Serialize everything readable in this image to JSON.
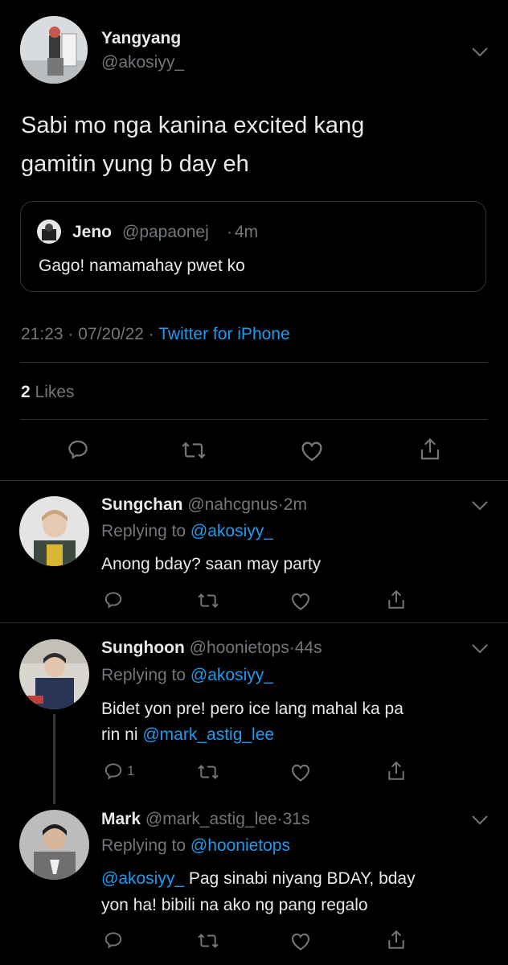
{
  "main_tweet": {
    "display_name": "Yangyang",
    "handle": "@akosiyy_",
    "text_line1": "Sabi mo nga kanina excited kang",
    "text_line2": "gamitin yung b day eh",
    "quote": {
      "display_name": "Jeno",
      "handle": "@papaonej",
      "time": "4m",
      "text": "Gago! namamahay pwet ko"
    },
    "timestamp": "21:23 · 07/20/22 · ",
    "source": "Twitter for iPhone",
    "likes_count": "2",
    "likes_label": "Likes"
  },
  "replies": [
    {
      "display_name": "Sungchan",
      "handle": "@nahcgnus",
      "time": "2m",
      "replying_label": "Replying to",
      "replying_to": "@akosiyy_",
      "text": "Anong bday? saan may party",
      "reply_count": ""
    },
    {
      "display_name": "Sunghoon",
      "handle": "@hoonietops",
      "time": "44s",
      "replying_label": "Replying to",
      "replying_to": "@akosiyy_",
      "text_line1": "Bidet yon pre! pero ice lang mahal ka pa",
      "text_line2_prefix": "rin ni ",
      "text_line2_mention": "@mark_astig_lee",
      "reply_count": "1"
    },
    {
      "display_name": "Mark",
      "handle": "@mark_astig_lee",
      "time": "31s",
      "replying_label": "Replying to",
      "replying_to": "@hoonietops",
      "text_mention": "@akosiyy_",
      "text_line1_rest": " Pag sinabi niyang BDAY, bday",
      "text_line2": "yon ha! bibili na ako ng pang regalo",
      "reply_count": ""
    }
  ],
  "colors": {
    "background": "#000000",
    "text": "#e7e9ea",
    "muted": "#71767b",
    "link": "#1d9bf0",
    "divider": "#2f3336"
  },
  "icons": [
    "chevron-down-icon",
    "reply-icon",
    "retweet-icon",
    "like-icon",
    "share-icon"
  ]
}
